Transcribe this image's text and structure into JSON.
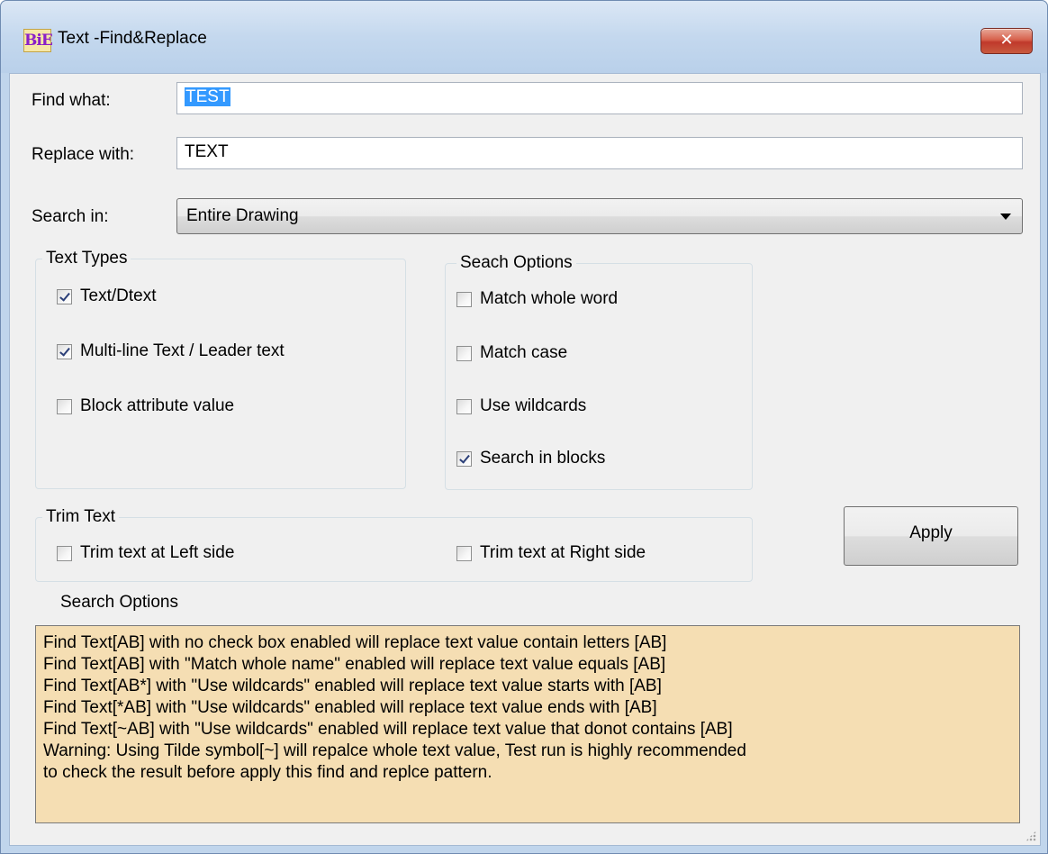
{
  "window": {
    "icon_text": "BiE",
    "title": "Text -Find&Replace",
    "close_glyph": "✕"
  },
  "find": {
    "label": "Find what:",
    "value": "TEST"
  },
  "replace": {
    "label": "Replace with:",
    "value": "TEXT"
  },
  "search_in": {
    "label": "Search in:",
    "selected": "Entire Drawing"
  },
  "text_types": {
    "title": "Text Types",
    "items": [
      {
        "label": "Text/Dtext",
        "checked": true
      },
      {
        "label": "Multi-line Text / Leader text",
        "checked": true
      },
      {
        "label": "Block attribute value",
        "checked": false
      }
    ]
  },
  "search_options": {
    "title": "Seach Options",
    "items": [
      {
        "label": "Match whole word",
        "checked": false
      },
      {
        "label": "Match case",
        "checked": false
      },
      {
        "label": "Use wildcards",
        "checked": false
      },
      {
        "label": "Search in blocks",
        "checked": true
      }
    ]
  },
  "trim": {
    "title": "Trim Text",
    "left": {
      "label": "Trim text at Left side",
      "checked": false
    },
    "right": {
      "label": "Trim text at Right side",
      "checked": false
    }
  },
  "apply_label": "Apply",
  "info": {
    "title": "Search Options",
    "lines": [
      "Find Text[AB] with no check box enabled will replace text value contain letters [AB]",
      "Find Text[AB] with \"Match whole name\" enabled will replace text value equals [AB]",
      "Find Text[AB*] with \"Use wildcards\" enabled will replace text value starts with [AB]",
      "Find Text[*AB] with \"Use wildcards\" enabled will replace text value ends with [AB]",
      "Find Text[~AB] with \"Use wildcards\" enabled will replace text value that donot contains [AB]",
      "Warning: Using Tilde symbol[~] will repalce whole text value, Test run is highly recommended",
      "to check the result before apply this find and replce pattern."
    ]
  },
  "colors": {
    "info_background": "#f5deb3",
    "selection": "#3399ff",
    "close_button": "#c0392b"
  }
}
